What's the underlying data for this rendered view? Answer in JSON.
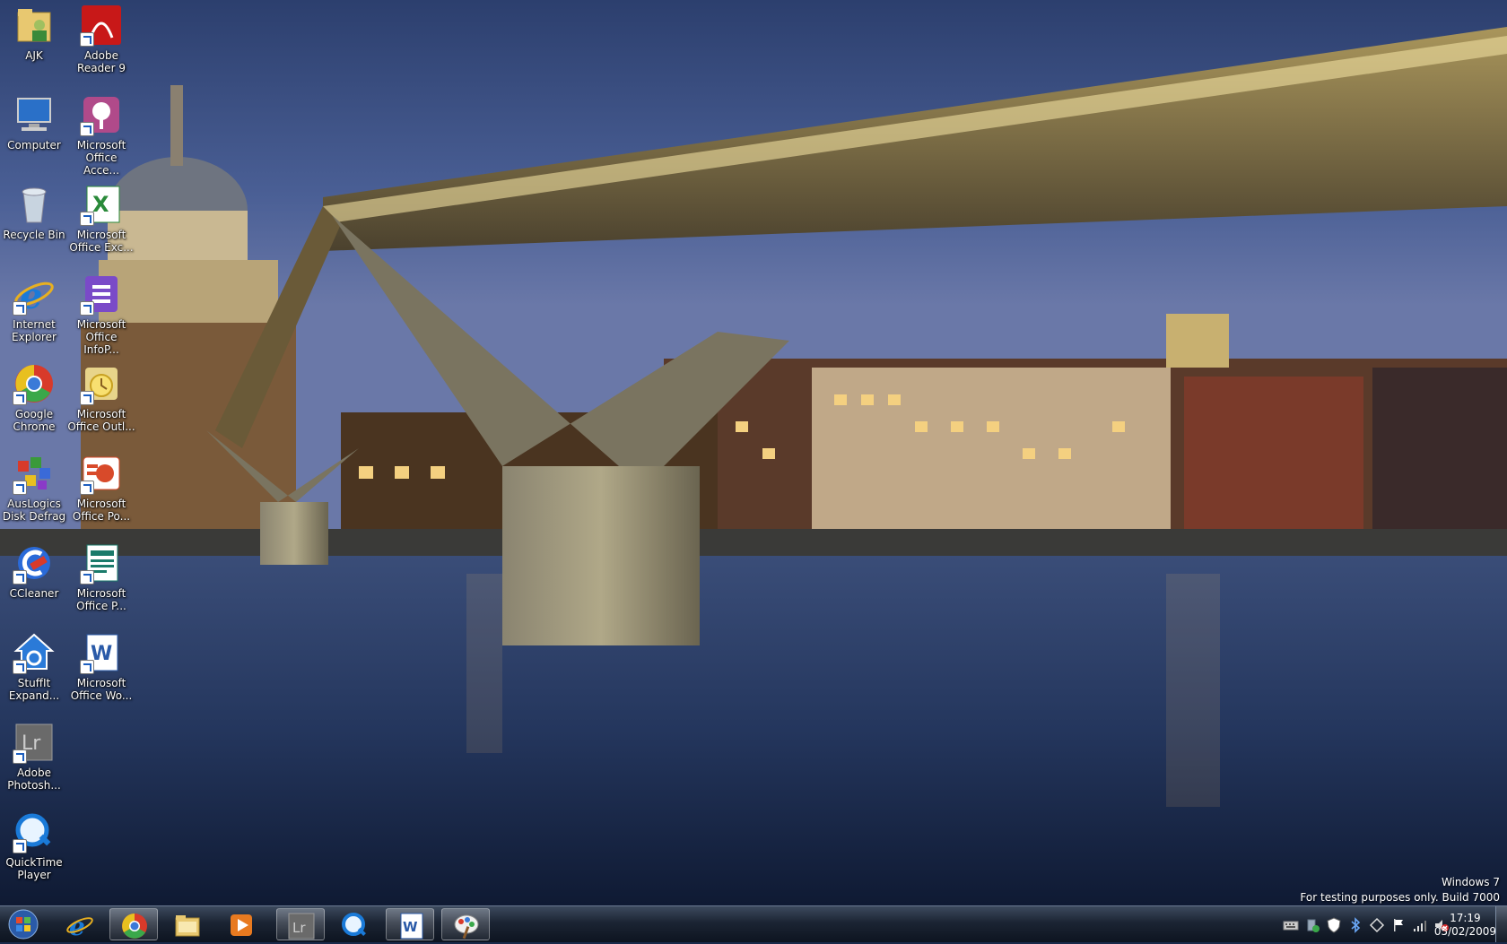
{
  "desktop_icons": [
    {
      "name": "desk-icon-ajk",
      "label": "AJK",
      "icon": "user-folder-icon",
      "shortcut": false
    },
    {
      "name": "desk-icon-adobe-reader",
      "label": "Adobe\nReader 9",
      "icon": "adobe-reader-icon",
      "shortcut": true
    },
    {
      "name": "desk-icon-computer",
      "label": "Computer",
      "icon": "computer-icon",
      "shortcut": false
    },
    {
      "name": "desk-icon-ms-access",
      "label": "Microsoft\nOffice Acce...",
      "icon": "access-icon",
      "shortcut": true
    },
    {
      "name": "desk-icon-recycle-bin",
      "label": "Recycle Bin",
      "icon": "recycle-bin-icon",
      "shortcut": false
    },
    {
      "name": "desk-icon-ms-excel",
      "label": "Microsoft\nOffice Exc...",
      "icon": "excel-icon",
      "shortcut": true
    },
    {
      "name": "desk-icon-internet-explorer",
      "label": "Internet\nExplorer",
      "icon": "internet-explorer-icon",
      "shortcut": true
    },
    {
      "name": "desk-icon-ms-infopath",
      "label": "Microsoft\nOffice InfoP...",
      "icon": "infopath-icon",
      "shortcut": true
    },
    {
      "name": "desk-icon-google-chrome",
      "label": "Google\nChrome",
      "icon": "chrome-icon",
      "shortcut": true
    },
    {
      "name": "desk-icon-ms-outlook",
      "label": "Microsoft\nOffice Outl...",
      "icon": "outlook-icon",
      "shortcut": true
    },
    {
      "name": "desk-icon-auslogics",
      "label": "AusLogics\nDisk Defrag",
      "icon": "disk-defrag-icon",
      "shortcut": true
    },
    {
      "name": "desk-icon-ms-powerpoint",
      "label": "Microsoft\nOffice Po...",
      "icon": "powerpoint-icon",
      "shortcut": true
    },
    {
      "name": "desk-icon-ccleaner",
      "label": "CCleaner",
      "icon": "ccleaner-icon",
      "shortcut": true
    },
    {
      "name": "desk-icon-ms-publisher",
      "label": "Microsoft\nOffice P...",
      "icon": "publisher-icon",
      "shortcut": true
    },
    {
      "name": "desk-icon-stuffit",
      "label": "StuffIt\nExpand...",
      "icon": "stuffit-icon",
      "shortcut": true
    },
    {
      "name": "desk-icon-ms-word",
      "label": "Microsoft\nOffice Wo...",
      "icon": "word-icon",
      "shortcut": true
    },
    {
      "name": "desk-icon-lightroom",
      "label": "Adobe\nPhotosh...",
      "icon": "lightroom-icon",
      "shortcut": true
    },
    {
      "name": "desk-icon-quicktime",
      "label": "QuickTime\nPlayer",
      "icon": "quicktime-icon",
      "shortcut": true
    }
  ],
  "watermark": {
    "line1": "Windows  7",
    "line2": "For testing purposes only. Build 7000"
  },
  "taskbar": {
    "start_icon": "windows-start-orb-icon",
    "pinned": [
      {
        "name": "taskbar-internet-explorer",
        "icon": "internet-explorer-icon",
        "active": false
      },
      {
        "name": "taskbar-google-chrome",
        "icon": "chrome-icon",
        "active": true
      },
      {
        "name": "taskbar-windows-explorer",
        "icon": "folder-icon",
        "active": false
      },
      {
        "name": "taskbar-media-player",
        "icon": "media-player-icon",
        "active": false
      },
      {
        "name": "taskbar-lightroom",
        "icon": "lightroom-icon",
        "active": true
      },
      {
        "name": "taskbar-quicktime",
        "icon": "quicktime-icon",
        "active": false
      },
      {
        "name": "taskbar-ms-word",
        "icon": "word-icon",
        "active": true
      },
      {
        "name": "taskbar-paint",
        "icon": "paint-icon",
        "active": true
      }
    ],
    "tray_icons": [
      "keyboard-icon",
      "safely-remove-icon",
      "security-shield-icon",
      "bluetooth-icon",
      "network-diamond-icon",
      "action-center-flag-icon",
      "signal-bars-icon",
      "volume-muted-icon"
    ],
    "clock": {
      "time": "17:19",
      "date": "05/02/2009"
    }
  },
  "colors": {
    "lightroom_text": "#cccccc",
    "ie_blue": "#1a7ad8",
    "word_blue": "#2a5aa8"
  }
}
